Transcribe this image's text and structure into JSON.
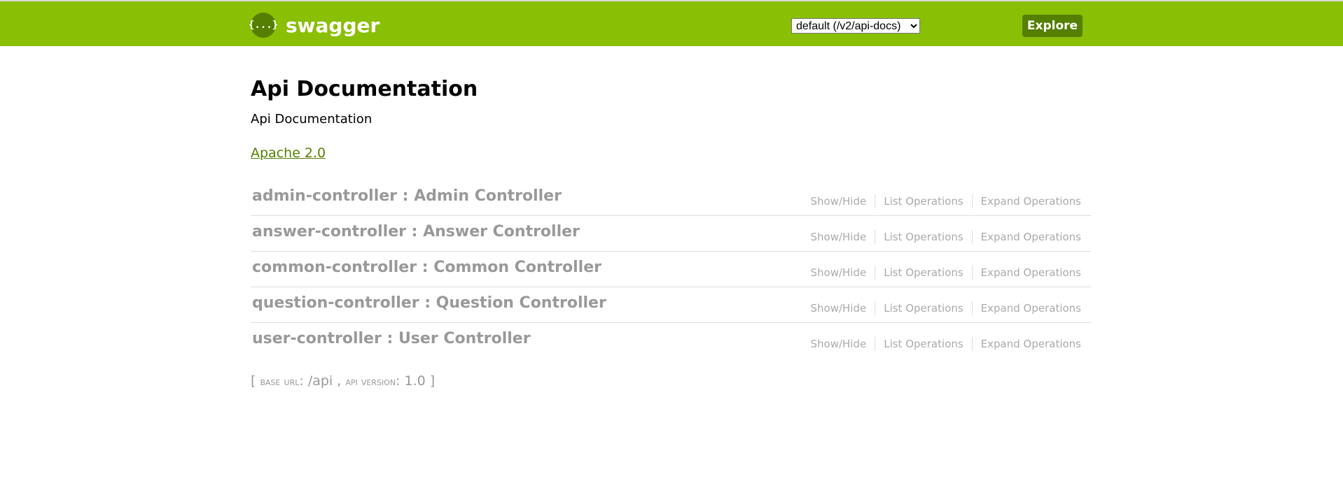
{
  "header": {
    "logo_icon": "{...}",
    "logo_text": "swagger",
    "spec_selected": "default (/v2/api-docs)",
    "spec_options": [
      "default (/v2/api-docs)"
    ],
    "explore_label": "Explore",
    "brand_color": "#89bf04",
    "accent_color": "#547f00"
  },
  "info": {
    "title": "Api Documentation",
    "description": "Api Documentation",
    "license": "Apache 2.0"
  },
  "resources": [
    {
      "name": "admin-controller",
      "sep": " : ",
      "description": "Admin Controller"
    },
    {
      "name": "answer-controller",
      "sep": " : ",
      "description": "Answer Controller"
    },
    {
      "name": "common-controller",
      "sep": " : ",
      "description": "Common Controller"
    },
    {
      "name": "question-controller",
      "sep": " : ",
      "description": "Question Controller"
    },
    {
      "name": "user-controller",
      "sep": " : ",
      "description": "User Controller"
    }
  ],
  "operations": {
    "show_hide": "Show/Hide",
    "list": "List Operations",
    "expand": "Expand Operations"
  },
  "footer": {
    "open_bracket": "[ ",
    "base_url_label": "base url",
    "base_url": "/api",
    "comma": " , ",
    "api_version_label": "api version",
    "api_version": "1.0",
    "close_bracket": " ]"
  }
}
